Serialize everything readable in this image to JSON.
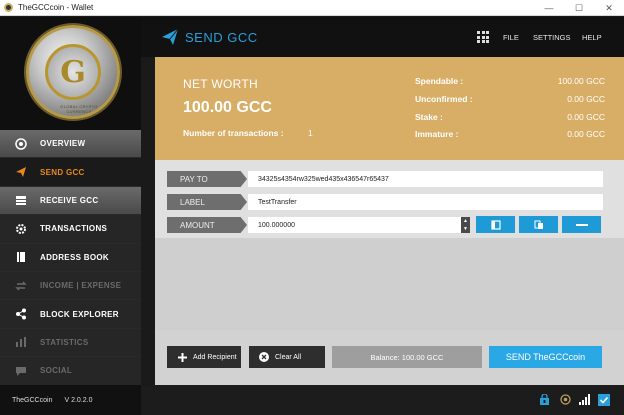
{
  "window": {
    "title": "TheGCCcoin - Wallet",
    "controls": [
      "—",
      "☐",
      "✕"
    ]
  },
  "sidebar": {
    "logo_text": "GLOBAL CRYPTO CURRENCY",
    "items": [
      {
        "label": "OVERVIEW",
        "icon": "overview-icon",
        "state": "normal"
      },
      {
        "label": "SEND GCC",
        "icon": "send-icon",
        "state": "active"
      },
      {
        "label": "RECEIVE GCC",
        "icon": "receive-icon",
        "state": "normal"
      },
      {
        "label": "TRANSACTIONS",
        "icon": "gear-icon",
        "state": "normal"
      },
      {
        "label": "ADDRESS BOOK",
        "icon": "book-icon",
        "state": "normal"
      },
      {
        "label": "INCOME | EXPENSE",
        "icon": "exchange-icon",
        "state": "disabled"
      },
      {
        "label": "BLOCK EXPLORER",
        "icon": "share-icon",
        "state": "normal"
      },
      {
        "label": "STATISTICS",
        "icon": "bar-chart-icon",
        "state": "disabled"
      },
      {
        "label": "SOCIAL",
        "icon": "chat-icon",
        "state": "disabled"
      }
    ],
    "coin_name": "TheGCCcoin",
    "version": "V 2.0.2.0"
  },
  "header": {
    "title": "SEND GCC",
    "menu": [
      "FILE",
      "SETTINGS",
      "HELP"
    ]
  },
  "networth": {
    "label": "NET WORTH",
    "value": "100.00 GCC",
    "tx_label": "Number of transactions :",
    "tx_count": "1",
    "balances": [
      {
        "k": "Spendable :",
        "v": "100.00 GCC"
      },
      {
        "k": "Unconfirmed :",
        "v": "0.00 GCC"
      },
      {
        "k": "Stake :",
        "v": "0.00 GCC"
      },
      {
        "k": "Immature :",
        "v": "0.00 GCC"
      }
    ]
  },
  "form": {
    "pay_to_label": "PAY TO",
    "pay_to_value": "34325s4354rw325wed435x436547r65437",
    "label_label": "LABEL",
    "label_value": "TestTransfer",
    "amount_label": "AMOUNT",
    "amount_value": "100.000000"
  },
  "bottom": {
    "add_recipient": "Add Recipient",
    "clear_all": "Clear All",
    "balance": "Balance: 100.00 GCC",
    "send": "SEND TheGCCcoin"
  },
  "colors": {
    "accent_blue": "#1e9bd7",
    "networth_bg": "#d8ad66",
    "active_nav": "#e88a1a"
  }
}
